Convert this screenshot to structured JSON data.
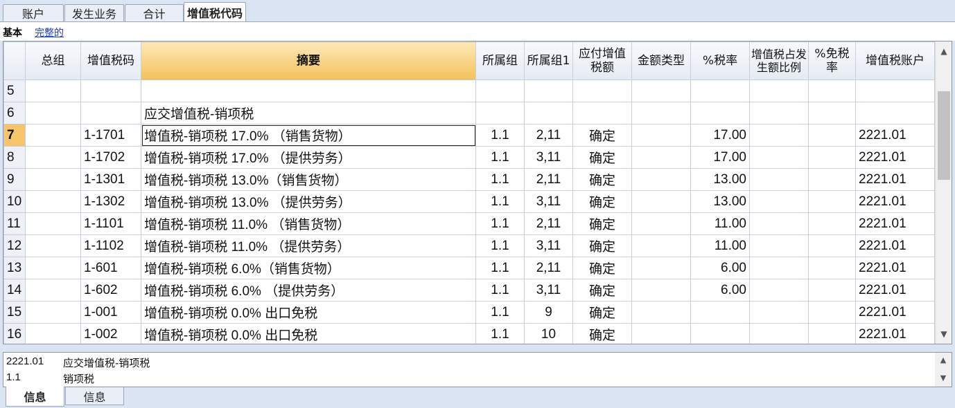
{
  "tabs": [
    "账户",
    "发生业务",
    "合计",
    "增值税代码"
  ],
  "views": {
    "basic": "基本",
    "full": "完整的"
  },
  "columns": [
    "总组",
    "增值税码",
    "摘要",
    "所属组",
    "所属组1",
    "应付增值税额",
    "金额类型",
    "%税率",
    "增值税占发生额比例",
    "%免税率",
    "增值税账户"
  ],
  "rows": [
    {
      "n": "5",
      "group": "",
      "code": "",
      "desc": "",
      "gr": "",
      "gr1": "",
      "amt": "",
      "rate": "",
      "acct": ""
    },
    {
      "n": "6",
      "group": "",
      "code": "",
      "desc": "应交增值税-销项税",
      "gr": "",
      "gr1": "",
      "amt": "",
      "rate": "",
      "acct": ""
    },
    {
      "n": "7",
      "group": "",
      "code": "1-1701",
      "desc": "增值税-销项税 17.0% （销售货物）",
      "gr": "1.1",
      "gr1": "2,11",
      "amt": "确定",
      "rate": "17.00",
      "acct": "2221.01"
    },
    {
      "n": "8",
      "group": "",
      "code": "1-1702",
      "desc": "增值税-销项税 17.0% （提供劳务）",
      "gr": "1.1",
      "gr1": "3,11",
      "amt": "确定",
      "rate": "17.00",
      "acct": "2221.01"
    },
    {
      "n": "9",
      "group": "",
      "code": "1-1301",
      "desc": "增值税-销项税 13.0%（销售货物）",
      "gr": "1.1",
      "gr1": "2,11",
      "amt": "确定",
      "rate": "13.00",
      "acct": "2221.01"
    },
    {
      "n": "10",
      "group": "",
      "code": "1-1302",
      "desc": "增值税-销项税 13.0% （提供劳务）",
      "gr": "1.1",
      "gr1": "3,11",
      "amt": "确定",
      "rate": "13.00",
      "acct": "2221.01"
    },
    {
      "n": "11",
      "group": "",
      "code": "1-1101",
      "desc": "增值税-销项税 11.0% （销售货物）",
      "gr": "1.1",
      "gr1": "2,11",
      "amt": "确定",
      "rate": "11.00",
      "acct": "2221.01"
    },
    {
      "n": "12",
      "group": "",
      "code": "1-1102",
      "desc": "增值税-销项税 11.0% （提供劳务）",
      "gr": "1.1",
      "gr1": "3,11",
      "amt": "确定",
      "rate": "11.00",
      "acct": "2221.01"
    },
    {
      "n": "13",
      "group": "",
      "code": "1-601",
      "desc": "增值税-销项税 6.0%（销售货物）",
      "gr": "1.1",
      "gr1": "2,11",
      "amt": "确定",
      "rate": "6.00",
      "acct": "2221.01"
    },
    {
      "n": "14",
      "group": "",
      "code": "1-602",
      "desc": "增值税-销项税 6.0% （提供劳务）",
      "gr": "1.1",
      "gr1": "3,11",
      "amt": "确定",
      "rate": "6.00",
      "acct": "2221.01"
    },
    {
      "n": "15",
      "group": "",
      "code": "1-001",
      "desc": "增值税-销项税  0.0% 出口免税",
      "gr": "1.1",
      "gr1": "9",
      "amt": "确定",
      "rate": "",
      "acct": "2221.01"
    },
    {
      "n": "16",
      "group": "",
      "code": "1-002",
      "desc": "增值税-销项税  0.0%  出口免税",
      "gr": "1.1",
      "gr1": "10",
      "amt": "确定",
      "rate": "",
      "acct": "2221.01"
    }
  ],
  "current_row": "7",
  "info": [
    {
      "k": "2221.01",
      "v": "应交增值税-销项税"
    },
    {
      "k": "1.1",
      "v": "销项税"
    }
  ],
  "bottom_tabs": [
    "信息",
    "信息"
  ],
  "icons": {
    "scroll_up": "chevron-up-icon",
    "scroll_down": "chevron-down-icon"
  }
}
